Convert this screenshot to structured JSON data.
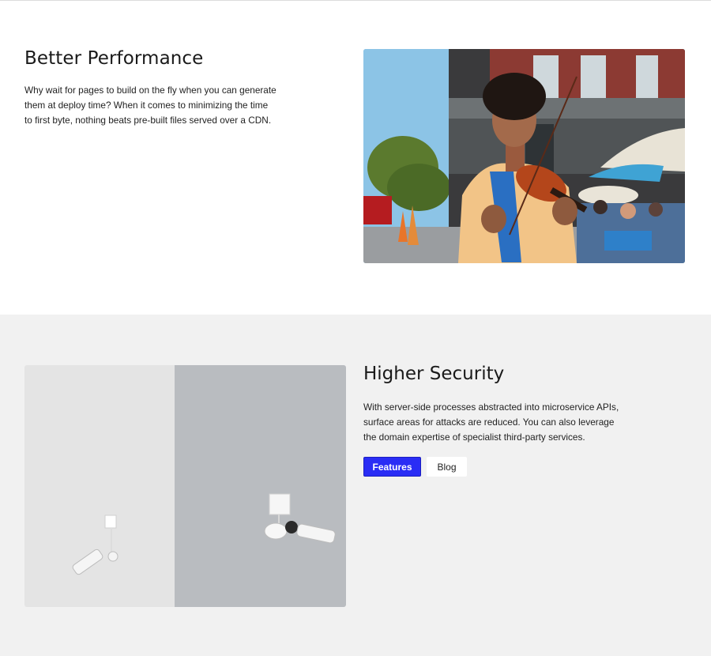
{
  "sections": {
    "performance": {
      "title": "Better Performance",
      "body": "Why wait for pages to build on the fly when you can generate them at deploy time? When it comes to minimizing the time to first byte, nothing beats pre-built files served over a CDN."
    },
    "security": {
      "title": "Higher Security",
      "body": "With server-side processes abstracted into microservice APIs, surface areas for attacks are reduced. You can also leverage the domain expertise of specialist third-party services.",
      "buttons": {
        "features": "Features",
        "blog": "Blog"
      }
    }
  },
  "colors": {
    "primary_button": "#2a2df5",
    "section_alt_background": "#f1f1f1"
  }
}
